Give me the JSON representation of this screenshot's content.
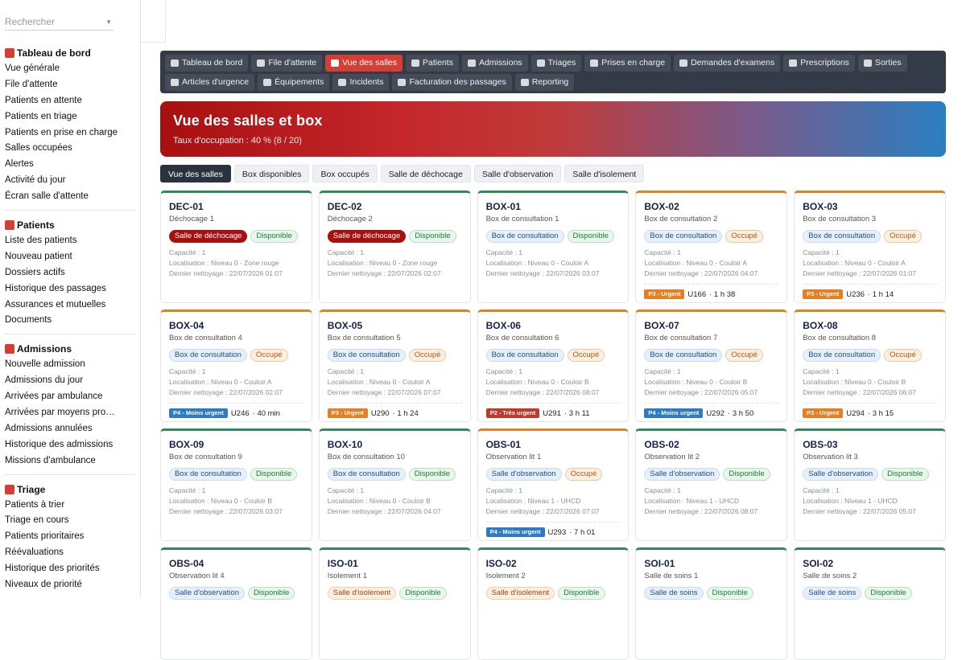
{
  "sidebar": {
    "search_placeholder": "Rechercher",
    "sections": [
      {
        "title": "Tableau de bord",
        "icon": "dashboard-icon",
        "color": "#d63e34",
        "items": [
          "Vue générale",
          "File d'attente",
          "Patients en attente",
          "Patients en triage",
          "Patients en prise en charge",
          "Salles occupées",
          "Alertes",
          "Activité du jour",
          "Écran salle d'attente"
        ]
      },
      {
        "title": "Patients",
        "icon": "id-card-icon",
        "color": "#d63e34",
        "items": [
          "Liste des patients",
          "Nouveau patient",
          "Dossiers actifs",
          "Historique des passages",
          "Assurances et mutuelles",
          "Documents"
        ]
      },
      {
        "title": "Admissions",
        "icon": "door-icon",
        "color": "#d63e34",
        "items": [
          "Nouvelle admission",
          "Admissions du jour",
          "Arrivées par ambulance",
          "Arrivées par moyens pro…",
          "Admissions annulées",
          "Historique des admissions",
          "Missions d'ambulance"
        ]
      },
      {
        "title": "Triage",
        "icon": "clipboard-icon",
        "color": "#d63e34",
        "items": [
          "Patients à trier",
          "Triage en cours",
          "Patients prioritaires",
          "Réévaluations",
          "Historique des priorités",
          "Niveaux de priorité"
        ]
      }
    ]
  },
  "nav": {
    "row1": [
      {
        "label": "Tableau de bord",
        "icon": "dashboard-icon",
        "active": false
      },
      {
        "label": "File d'attente",
        "icon": "list-icon",
        "active": false
      },
      {
        "label": "Vue des salles",
        "icon": "bed-icon",
        "active": true
      },
      {
        "label": "Patients",
        "icon": "id-card-icon",
        "active": false
      },
      {
        "label": "Admissions",
        "icon": "door-icon",
        "active": false
      },
      {
        "label": "Triages",
        "icon": "clipboard-icon",
        "active": false
      },
      {
        "label": "Prises en charge",
        "icon": "user-doctor-icon",
        "active": false
      },
      {
        "label": "Demandes d'examens",
        "icon": "microscope-icon",
        "active": false
      },
      {
        "label": "Prescriptions",
        "icon": "pills-icon",
        "active": false
      },
      {
        "label": "Sorties",
        "icon": "exit-icon",
        "active": false
      }
    ],
    "row2": [
      {
        "label": "Articles d'urgence",
        "icon": "sitemap-icon",
        "active": false
      },
      {
        "label": "Équipements",
        "icon": "stethoscope-icon",
        "active": false
      },
      {
        "label": "Incidents",
        "icon": "warning-icon",
        "active": false
      },
      {
        "label": "Facturation des passages",
        "icon": "invoice-icon",
        "active": false
      },
      {
        "label": "Reporting",
        "icon": "chart-pie-icon",
        "active": false
      }
    ]
  },
  "hero": {
    "title": "Vue des salles et box",
    "subtitle": "Taux d'occupation : 40 % (8 / 20)"
  },
  "tabs": [
    {
      "label": "Vue des salles",
      "active": true
    },
    {
      "label": "Box disponibles",
      "active": false
    },
    {
      "label": "Box occupés",
      "active": false
    },
    {
      "label": "Salle de déchocage",
      "active": false
    },
    {
      "label": "Salle d'observation",
      "active": false
    },
    {
      "label": "Salle d'isolement",
      "active": false
    }
  ],
  "labels": {
    "capacity": "Capacité : 1",
    "loc_prefix": "Localisation : ",
    "clean_prefix": "Dernier nettoyage : "
  },
  "rooms": [
    {
      "code": "DEC-01",
      "name": "Déchocage 1",
      "type": "Salle de déchocage",
      "type_style": "dec",
      "status": "Disponible",
      "location": "Niveau 0 - Zone rouge",
      "cleaned": "22/07/2026 01:07",
      "occupant": null
    },
    {
      "code": "DEC-02",
      "name": "Déchocage 2",
      "type": "Salle de déchocage",
      "type_style": "dec",
      "status": "Disponible",
      "location": "Niveau 0 - Zone rouge",
      "cleaned": "22/07/2026 02:07",
      "occupant": null
    },
    {
      "code": "BOX-01",
      "name": "Box de consultation 1",
      "type": "Box de consultation",
      "type_style": "cons",
      "status": "Disponible",
      "location": "Niveau 0 - Couloir A",
      "cleaned": "22/07/2026 03:07",
      "occupant": null
    },
    {
      "code": "BOX-02",
      "name": "Box de consultation 2",
      "type": "Box de consultation",
      "type_style": "cons",
      "status": "Occupé",
      "location": "Niveau 0 - Couloir A",
      "cleaned": "22/07/2026 04:07",
      "occupant": {
        "priority": "P3 - Urgent",
        "prio_style": "orange",
        "patient": "U166",
        "duration": "1 h 38"
      }
    },
    {
      "code": "BOX-03",
      "name": "Box de consultation 3",
      "type": "Box de consultation",
      "type_style": "cons",
      "status": "Occupé",
      "location": "Niveau 0 - Couloir A",
      "cleaned": "22/07/2026 01:07",
      "occupant": {
        "priority": "P3 - Urgent",
        "prio_style": "orange",
        "patient": "U236",
        "duration": "1 h 14"
      }
    },
    {
      "code": "BOX-04",
      "name": "Box de consultation 4",
      "type": "Box de consultation",
      "type_style": "cons",
      "status": "Occupé",
      "location": "Niveau 0 - Couloir A",
      "cleaned": "22/07/2026 02:07",
      "occupant": {
        "priority": "P4 - Moins urgent",
        "prio_style": "blue",
        "patient": "U246",
        "duration": "40 min"
      }
    },
    {
      "code": "BOX-05",
      "name": "Box de consultation 5",
      "type": "Box de consultation",
      "type_style": "cons",
      "status": "Occupé",
      "location": "Niveau 0 - Couloir A",
      "cleaned": "22/07/2026 07:07",
      "occupant": {
        "priority": "P3 - Urgent",
        "prio_style": "orange",
        "patient": "U290",
        "duration": "1 h 24"
      }
    },
    {
      "code": "BOX-06",
      "name": "Box de consultation 6",
      "type": "Box de consultation",
      "type_style": "cons",
      "status": "Occupé",
      "location": "Niveau 0 - Couloir B",
      "cleaned": "22/07/2026 08:07",
      "occupant": {
        "priority": "P2 - Très urgent",
        "prio_style": "red",
        "patient": "U291",
        "duration": "3 h 11"
      }
    },
    {
      "code": "BOX-07",
      "name": "Box de consultation 7",
      "type": "Box de consultation",
      "type_style": "cons",
      "status": "Occupé",
      "location": "Niveau 0 - Couloir B",
      "cleaned": "22/07/2026 05:07",
      "occupant": {
        "priority": "P4 - Moins urgent",
        "prio_style": "blue",
        "patient": "U292",
        "duration": "3 h 50"
      }
    },
    {
      "code": "BOX-08",
      "name": "Box de consultation 8",
      "type": "Box de consultation",
      "type_style": "cons",
      "status": "Occupé",
      "location": "Niveau 0 - Couloir B",
      "cleaned": "22/07/2026 06:07",
      "occupant": {
        "priority": "P3 - Urgent",
        "prio_style": "orange",
        "patient": "U294",
        "duration": "3 h 15"
      }
    },
    {
      "code": "BOX-09",
      "name": "Box de consultation 9",
      "type": "Box de consultation",
      "type_style": "cons",
      "status": "Disponible",
      "location": "Niveau 0 - Couloir B",
      "cleaned": "22/07/2026 03:07",
      "occupant": null
    },
    {
      "code": "BOX-10",
      "name": "Box de consultation 10",
      "type": "Box de consultation",
      "type_style": "cons",
      "status": "Disponible",
      "location": "Niveau 0 - Couloir B",
      "cleaned": "22/07/2026 04:07",
      "occupant": null
    },
    {
      "code": "OBS-01",
      "name": "Observation lit 1",
      "type": "Salle d'observation",
      "type_style": "cons",
      "status": "Occupé",
      "location": "Niveau 1 - UHCD",
      "cleaned": "22/07/2026 07:07",
      "occupant": {
        "priority": "P4 - Moins urgent",
        "prio_style": "blue",
        "patient": "U293",
        "duration": "7 h 01"
      }
    },
    {
      "code": "OBS-02",
      "name": "Observation lit 2",
      "type": "Salle d'observation",
      "type_style": "cons",
      "status": "Disponible",
      "location": "Niveau 1 - UHCD",
      "cleaned": "22/07/2026 08:07",
      "occupant": null
    },
    {
      "code": "OBS-03",
      "name": "Observation lit 3",
      "type": "Salle d'observation",
      "type_style": "cons",
      "status": "Disponible",
      "location": "Niveau 1 - UHCD",
      "cleaned": "22/07/2026 05:07",
      "occupant": null
    },
    {
      "code": "OBS-04",
      "name": "Observation lit 4",
      "type": "Salle d'observation",
      "type_style": "cons",
      "status": "Disponible",
      "location": "",
      "cleaned": "",
      "occupant": null
    },
    {
      "code": "ISO-01",
      "name": "Isolement 1",
      "type": "Salle d'isolement",
      "type_style": "iso",
      "status": "Disponible",
      "location": "",
      "cleaned": "",
      "occupant": null
    },
    {
      "code": "ISO-02",
      "name": "Isolement 2",
      "type": "Salle d'isolement",
      "type_style": "iso",
      "status": "Disponible",
      "location": "",
      "cleaned": "",
      "occupant": null
    },
    {
      "code": "SOI-01",
      "name": "Salle de soins 1",
      "type": "Salle de soins",
      "type_style": "cons",
      "status": "Disponible",
      "location": "",
      "cleaned": "",
      "occupant": null
    },
    {
      "code": "SOI-02",
      "name": "Salle de soins 2",
      "type": "Salle de soins",
      "type_style": "cons",
      "status": "Disponible",
      "location": "",
      "cleaned": "",
      "occupant": null
    }
  ]
}
